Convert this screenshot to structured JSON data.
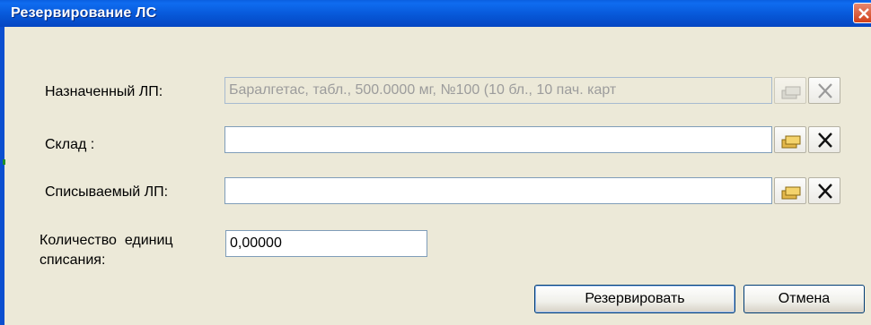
{
  "window": {
    "title": "Резервирование ЛС"
  },
  "fields": {
    "assigned": {
      "label": "Назначенный ЛП:",
      "value": "Баралгетас, табл., 500.0000 мг, №100 (10 бл., 10 пач. карт"
    },
    "warehouse": {
      "label": "Склад :",
      "value": ""
    },
    "writeoff": {
      "label": "Списываемый ЛП:",
      "value": ""
    },
    "quantity": {
      "label_line1": "Количество  единиц",
      "label_line2": "списания:",
      "value": "0,00000"
    }
  },
  "buttons": {
    "reserve": "Резервировать",
    "cancel": "Отмена"
  },
  "icons": {
    "select": "folders-icon",
    "clear": "clear-x-icon"
  },
  "colors": {
    "titlebar": "#0758d8",
    "dialog_bg": "#ece9d8",
    "field_border": "#7f9db9"
  }
}
